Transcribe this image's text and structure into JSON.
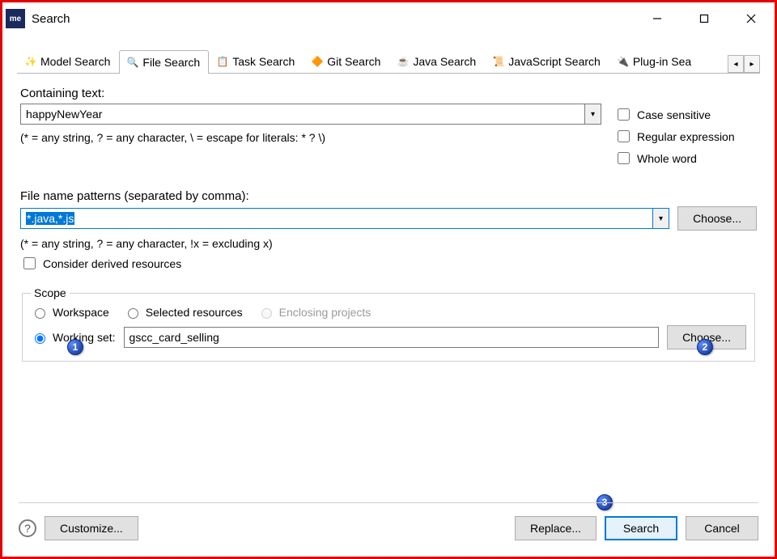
{
  "window": {
    "title": "Search",
    "app_badge": "me"
  },
  "tabs": [
    {
      "label": "Model Search"
    },
    {
      "label": "File Search"
    },
    {
      "label": "Task Search"
    },
    {
      "label": "Git Search"
    },
    {
      "label": "Java Search"
    },
    {
      "label": "JavaScript Search"
    },
    {
      "label": "Plug-in Sea"
    }
  ],
  "containing": {
    "label": "Containing text:",
    "value": "happyNewYear",
    "hint": "(* = any string, ? = any character, \\ = escape for literals: * ? \\)"
  },
  "options": {
    "case_sensitive": "Case sensitive",
    "regex": "Regular expression",
    "whole_word": "Whole word"
  },
  "patterns": {
    "label": "File name patterns (separated by comma):",
    "value": "*.java,*.js",
    "choose": "Choose...",
    "hint": "(* = any string, ? = any character, !x = excluding x)",
    "derived": "Consider derived resources"
  },
  "scope": {
    "legend": "Scope",
    "workspace": "Workspace",
    "selected": "Selected resources",
    "enclosing": "Enclosing projects",
    "working_set": "Working set:",
    "working_set_value": "gscc_card_selling",
    "choose": "Choose..."
  },
  "footer": {
    "customize": "Customize...",
    "replace": "Replace...",
    "search": "Search",
    "cancel": "Cancel"
  },
  "badges": {
    "b1": "1",
    "b2": "2",
    "b3": "3"
  }
}
